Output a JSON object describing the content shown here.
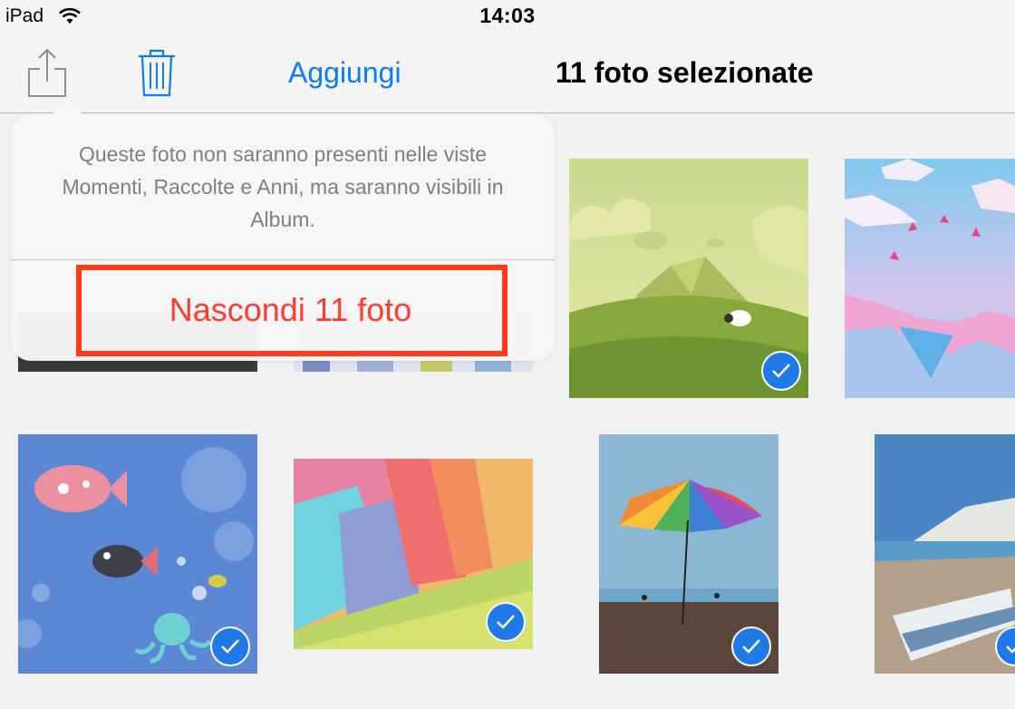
{
  "status_bar": {
    "device": "iPad",
    "time": "14:03"
  },
  "toolbar": {
    "share_icon": "share-icon",
    "trash_icon": "trash-icon",
    "add_label": "Aggiungi",
    "title": "11 foto selezionate",
    "accent_color": "#0a7aff"
  },
  "popover": {
    "message": "Queste foto non saranno presenti nelle viste Momenti, Raccolte e Anni, ma saranno visibili in Album.",
    "hide_label": "Nascondi 11 foto",
    "destructive_color": "#ff3b30",
    "highlight_color": "#ff3a1a"
  },
  "photos": [
    {
      "name": "dark-photo",
      "selected": true
    },
    {
      "name": "colorful-partial-photo",
      "selected": true
    },
    {
      "name": "sheep-hill-illustration",
      "selected": true
    },
    {
      "name": "origami-sky-illustration",
      "selected": true
    },
    {
      "name": "fish-underwater-illustration",
      "selected": true
    },
    {
      "name": "colorful-polygon-wallpaper",
      "selected": true
    },
    {
      "name": "rainbow-umbrella-beach-photo",
      "selected": true
    },
    {
      "name": "boat-cliffs-photo",
      "selected": true
    }
  ],
  "check_color": "#1f7ae8"
}
